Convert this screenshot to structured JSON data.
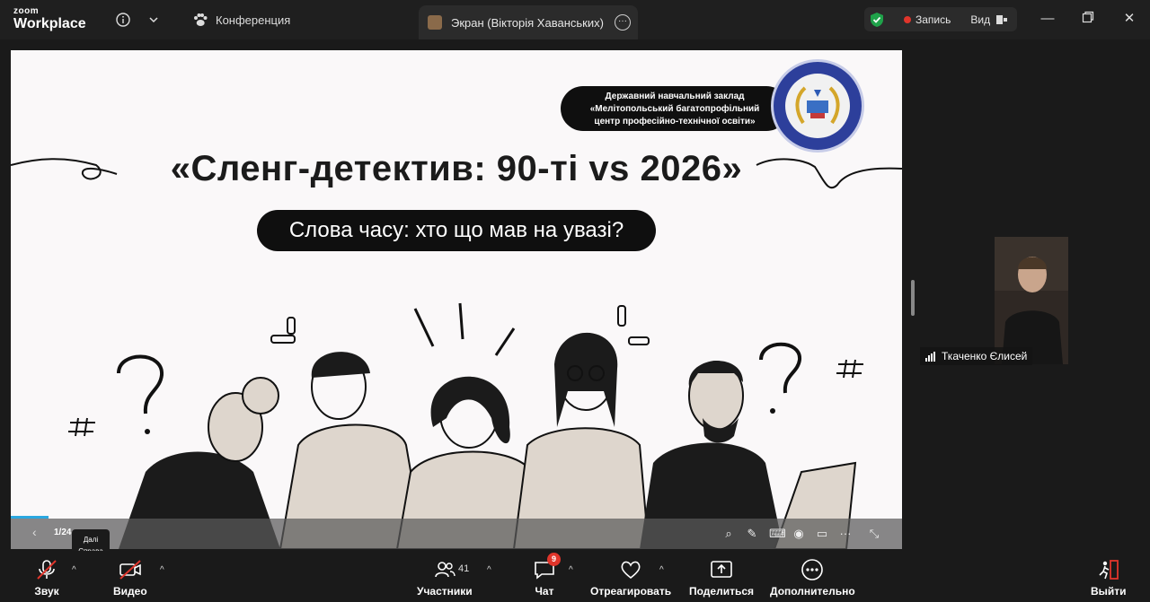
{
  "titlebar": {
    "brand_top": "zoom",
    "brand_bottom": "Workplace",
    "conference_label": "Конференция",
    "screen_tab_label": "Экран (Вікторія Хаванських)",
    "record_label": "Запись",
    "view_label": "Вид"
  },
  "slide": {
    "org_line1": "Державний навчальний заклад",
    "org_line2": "«Мелітопольський багатопрофільний",
    "org_line3": "центр професійно-технічної освіти»",
    "title": "«Сленг-детектив: 90-ті vs 2026»",
    "subtitle": "Слова часу: хто що мав на увазі?",
    "page_indicator": "1/24",
    "tooltip_line1": "Далі",
    "tooltip_line2": "Справа"
  },
  "participant": {
    "name": "Ткаченко Єлисей"
  },
  "controls": {
    "audio": "Звук",
    "video": "Видео",
    "participants": "Участники",
    "participants_count": "41",
    "chat": "Чат",
    "chat_badge": "9",
    "react": "Отреагировать",
    "share": "Поделиться",
    "more": "Дополнительно",
    "leave": "Выйти"
  },
  "colors": {
    "accent_red": "#e0352b",
    "shield_green": "#1fa24a",
    "progress_blue": "#2aa7e0"
  }
}
